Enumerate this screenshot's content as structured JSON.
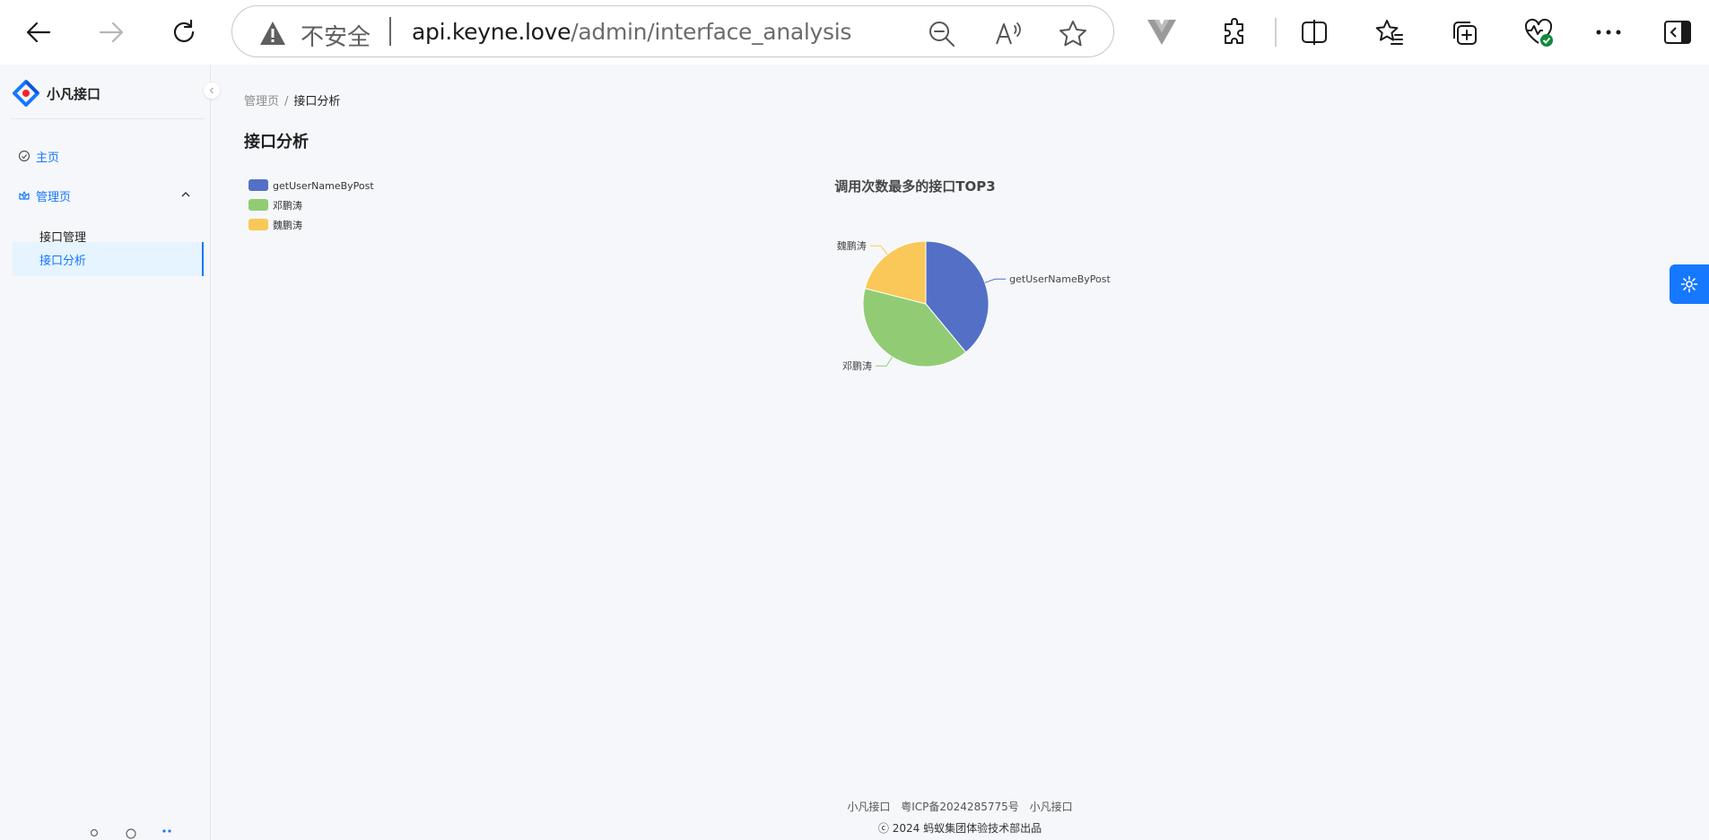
{
  "browser": {
    "insecure_label": "不安全",
    "url_host": "api.keyne.love",
    "url_path": "/admin/interface_analysis",
    "icons": [
      "back-icon",
      "forward-icon",
      "refresh-icon",
      "warning-icon",
      "zoom-out-icon",
      "read-aloud-icon",
      "favorite-star-icon",
      "vue-devtools-icon",
      "extensions-icon",
      "split-screen-icon",
      "favorites-icon",
      "collections-icon",
      "browser-essentials-icon",
      "more-icon",
      "sidebar-icon"
    ]
  },
  "sidebar": {
    "logo_text": "小凡接口",
    "items": [
      {
        "label": "主页",
        "icon": "dashboard-icon"
      },
      {
        "label": "管理页",
        "icon": "crown-icon"
      },
      {
        "label": "接口管理"
      },
      {
        "label": "接口分析"
      }
    ]
  },
  "breadcrumb": {
    "parent": "管理页",
    "separator": "/",
    "current": "接口分析"
  },
  "page_title": "接口分析",
  "chart_data": {
    "type": "pie",
    "title": "调用次数最多的接口TOP3",
    "legend_position": "top-left",
    "slices": [
      {
        "name": "getUserNameByPost",
        "value": 39,
        "color": "#5470c6"
      },
      {
        "name": "邓鹏涛",
        "value": 40,
        "color": "#91cc75"
      },
      {
        "name": "魏鹏涛",
        "value": 21,
        "color": "#fac858"
      }
    ]
  },
  "footer": {
    "link1": "小凡接口",
    "link2": "粤ICP备2024285775号",
    "link3": "小凡接口",
    "copyright": "ⓒ 2024 蚂蚁集团体验技术部出品"
  },
  "colors": {
    "primary": "#1677ff",
    "page_bg": "#f5f7fa"
  }
}
